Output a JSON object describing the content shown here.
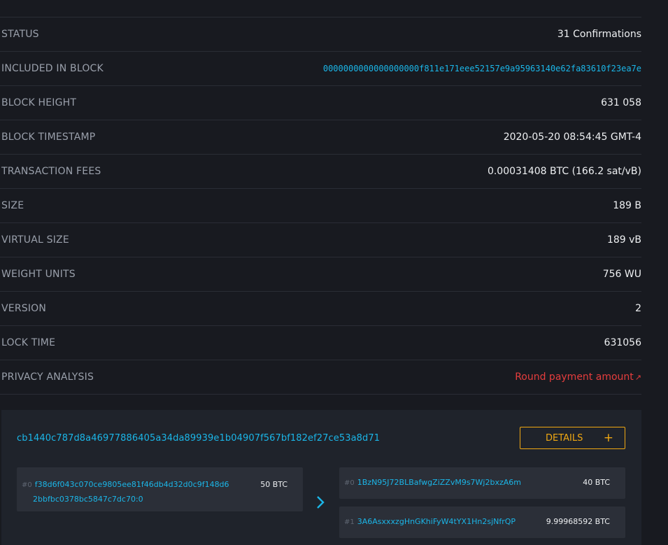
{
  "details": {
    "rows": [
      {
        "label": "STATUS",
        "value": "31 Confirmations"
      },
      {
        "label": "INCLUDED IN BLOCK",
        "value": "0000000000000000000f811e171eee52157e9a95963140e62fa83610f23ea7e"
      },
      {
        "label": "BLOCK HEIGHT",
        "value": "631 058"
      },
      {
        "label": "BLOCK TIMESTAMP",
        "value": "2020-05-20 08:54:45 GMT-4"
      },
      {
        "label": "TRANSACTION FEES",
        "value": "0.00031408 BTC (166.2 sat/vB)"
      },
      {
        "label": "SIZE",
        "value": "189 B"
      },
      {
        "label": "VIRTUAL SIZE",
        "value": "189 vB"
      },
      {
        "label": "WEIGHT UNITS",
        "value": "756 WU"
      },
      {
        "label": "VERSION",
        "value": "2"
      },
      {
        "label": "LOCK TIME",
        "value": "631056"
      },
      {
        "label": "PRIVACY ANALYSIS",
        "value": "Round payment amount"
      }
    ]
  },
  "transaction": {
    "txid": "cb1440c787d8a46977886405a34da89939e1b04907f567bf182ef27ce53a8d71",
    "details_label": "DETAILS",
    "details_icon": "+",
    "inputs": [
      {
        "index": "#0",
        "address_line1": "f38d6f043c070ce9805ee81f46db4d32d0c9f148d6",
        "address_line2": "2bbfbc0378bc5847c7dc70:0",
        "amount": "50 BTC"
      }
    ],
    "outputs": [
      {
        "index": "#0",
        "address": "1BzN95J72BLBafwgZiZZvM9s7Wj2bxzA6m",
        "amount": "40 BTC"
      },
      {
        "index": "#1",
        "address": "3A6AsxxxzgHnGKhiFyW4tYX1Hn2sjNfrQP",
        "amount": "9.99968592 BTC"
      }
    ]
  },
  "colors": {
    "background": "#181a20",
    "card": "#1f232b",
    "link": "#1bb6e8",
    "accent": "#f0a812",
    "warning": "#e53d3d"
  },
  "icons": {
    "privacy_link": "external-link-icon",
    "flow": "chevron-right-icon",
    "details": "plus-icon"
  }
}
